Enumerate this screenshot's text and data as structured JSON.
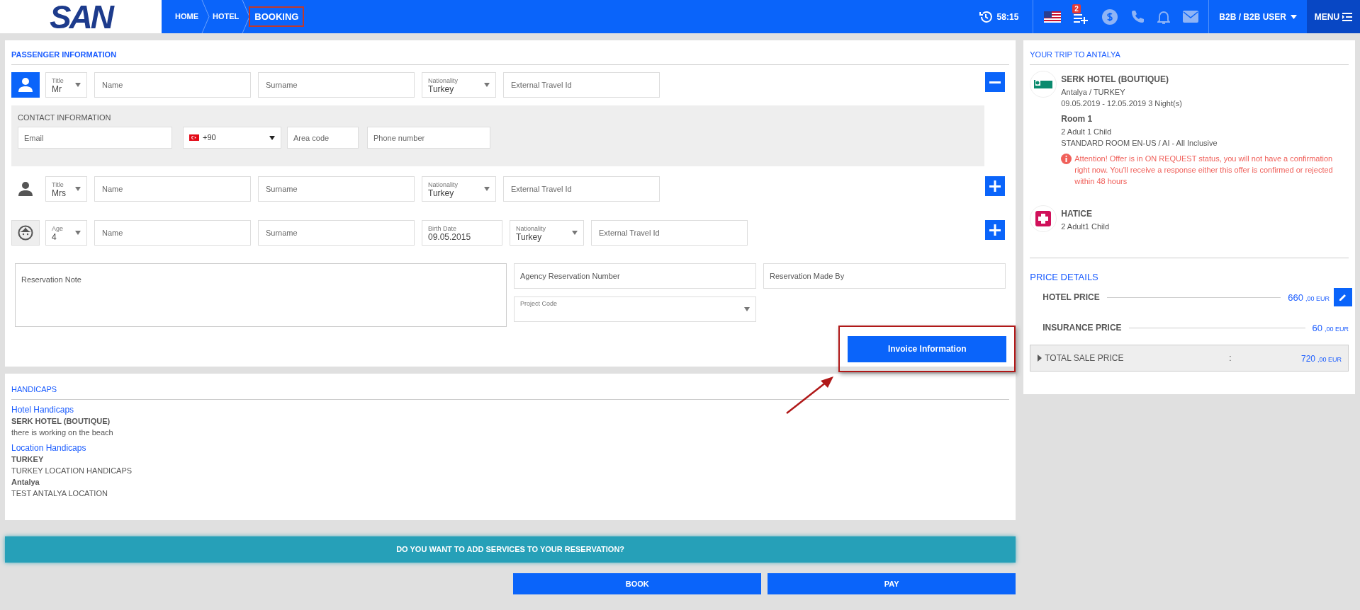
{
  "header": {
    "logo": "SAN",
    "breadcrumbs": [
      {
        "label": "HOME",
        "current": false,
        "highlighted": false
      },
      {
        "label": "HOTEL",
        "current": false,
        "highlighted": false
      },
      {
        "label": "BOOKING",
        "current": true,
        "highlighted": true
      }
    ],
    "timer": "58:15",
    "cart_count": "2",
    "user": "B2B / B2B USER",
    "menu": "MENU"
  },
  "passenger_section": {
    "title": "PASSENGER INFORMATION",
    "passengers": [
      {
        "kind": "adult",
        "selected": true,
        "removable": true,
        "fields": [
          {
            "kind": "title",
            "label": "Title",
            "value": "Mr"
          },
          {
            "kind": "name",
            "placeholder": "Name"
          },
          {
            "kind": "surname",
            "placeholder": "Surname"
          },
          {
            "kind": "nationality",
            "label": "Nationality",
            "value": "Turkey"
          },
          {
            "kind": "external",
            "placeholder": "External Travel Id"
          }
        ]
      },
      {
        "kind": "adult",
        "selected": false,
        "removable": false,
        "fields": [
          {
            "kind": "title",
            "label": "Title",
            "value": "Mrs"
          },
          {
            "kind": "name",
            "placeholder": "Name"
          },
          {
            "kind": "surname",
            "placeholder": "Surname"
          },
          {
            "kind": "nationality",
            "label": "Nationality",
            "value": "Turkey"
          },
          {
            "kind": "external",
            "placeholder": "External Travel Id"
          }
        ]
      },
      {
        "kind": "child",
        "selected": false,
        "removable": false,
        "fields": [
          {
            "kind": "title",
            "label": "Age",
            "value": "4"
          },
          {
            "kind": "name",
            "placeholder": "Name"
          },
          {
            "kind": "surname",
            "placeholder": "Surname"
          },
          {
            "kind": "birthdate",
            "label": "Birth Date",
            "value": "09.05.2015"
          },
          {
            "kind": "nationality",
            "label": "Nationality",
            "value": "Turkey"
          },
          {
            "kind": "external",
            "placeholder": "External Travel Id"
          }
        ]
      }
    ],
    "contact": {
      "title": "CONTACT INFORMATION",
      "email_placeholder": "Email",
      "phone_code": "+90",
      "area_code_placeholder": "Area code",
      "phone_placeholder": "Phone number"
    },
    "reservation_note_placeholder": "Reservation Note",
    "agency_number_placeholder": "Agency Reservation Number",
    "made_by_placeholder": "Reservation Made By",
    "project_code_label": "Project Code",
    "invoice_button": {
      "label": "Invoice Information",
      "highlighted": true
    }
  },
  "handicaps": {
    "title": "HANDICAPS",
    "groups": [
      {
        "heading": "Hotel Handicaps",
        "entries": [
          {
            "name": "SERK HOTEL (BOUTIQUE)",
            "text": "there is working on the beach"
          }
        ]
      },
      {
        "heading": "Location Handicaps",
        "entries": [
          {
            "name": "TURKEY",
            "text": "TURKEY LOCATION HANDICAPS"
          },
          {
            "name": "Antalya",
            "text": "TEST ANTALYA LOCATION"
          }
        ]
      }
    ]
  },
  "services_bar": "DO YOU WANT TO ADD SERVICES TO YOUR RESERVATION?",
  "actions": [
    "BOOK",
    "PAY"
  ],
  "trip": {
    "title": "YOUR TRIP TO ANTALYA",
    "items": [
      {
        "kind": "hotel",
        "name": "SERK HOTEL (BOUTIQUE)",
        "lines": [
          "Antalya / TURKEY",
          "09.05.2019 - 12.05.2019 3 Night(s)"
        ],
        "room_title": "Room 1",
        "room_lines": [
          "2 Adult 1 Child",
          "STANDARD ROOM EN-US / AI - All Inclusive"
        ],
        "warning": "Attention! Offer is in ON REQUEST status, you will not have a confirmation right now. You'll receive a response either this offer is confirmed or rejected within 48 hours"
      },
      {
        "kind": "insurance",
        "name": "HATICE",
        "lines": [
          "2 Adult1 Child"
        ]
      }
    ]
  },
  "price_details": {
    "title": "PRICE DETAILS",
    "lines": [
      {
        "label": "HOTEL PRICE",
        "amount": "660",
        "fraction": ",00 EUR",
        "editable": true
      },
      {
        "label": "INSURANCE PRICE",
        "amount": "60",
        "fraction": ",00 EUR",
        "editable": false
      }
    ],
    "total": {
      "label": "TOTAL SALE PRICE",
      "separator": ":",
      "amount": "720",
      "fraction": ",00 EUR",
      "expanded": false
    }
  }
}
